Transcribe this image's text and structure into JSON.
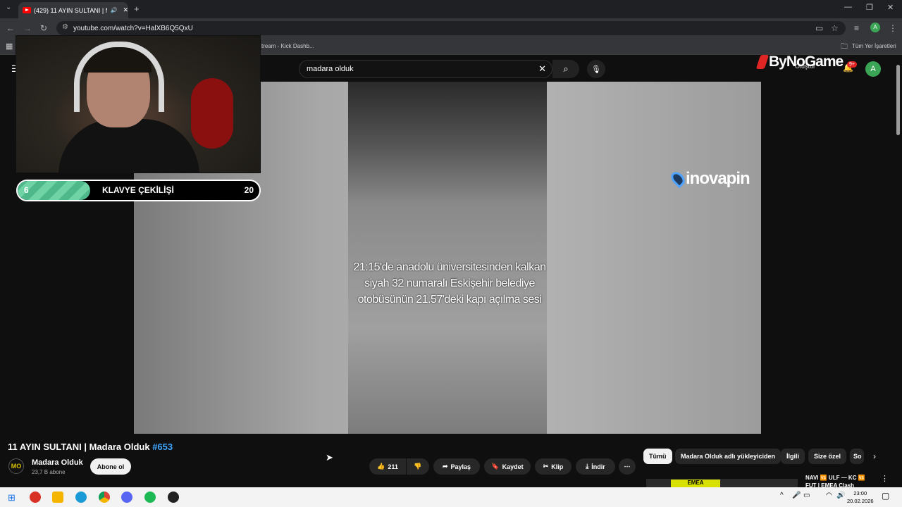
{
  "browser": {
    "tab_title": "(429) 11 AYIN SULTANI | M...",
    "url": "youtube.com/watch?v=HalXB6Q5QxU",
    "bookmark_partial": "tream - Kick Dashb...",
    "all_bookmarks": "Tüm Yer İşaretleri"
  },
  "youtube": {
    "search_query": "madara olduk",
    "create_label": "Oluştur",
    "notification_count": "9+",
    "avatar_letter": "A"
  },
  "overlay": {
    "giveaway_label": "KLAVYE ÇEKİLİŞİ",
    "giveaway_current": "6",
    "giveaway_target": "20",
    "giveaway_progress": 0.3,
    "sponsor_brand": "ByNoGame",
    "video_watermark": "inovapin",
    "channel_watermark": "MO"
  },
  "video": {
    "caption": "21:15'de anadolu üniversitesinden kalkan siyah 32 numaralı Eskişehir belediye otobüsünün 21.57'deki kapı açılma sesi",
    "title": "11 AYIN SULTANI | Madara Olduk",
    "episode": "#653",
    "channel_name": "Madara Olduk",
    "channel_subs": "23,7 B abone",
    "subscribe_label": "Abone ol",
    "likes": "211",
    "share_label": "Paylaş",
    "save_label": "Kaydet",
    "clip_label": "Klip",
    "download_label": "İndir"
  },
  "chips": [
    "Tümü",
    "Madara Olduk adlı yükleyiciden",
    "İlgili",
    "Size özel",
    "So"
  ],
  "recommended": {
    "thumb_text": "EMEA",
    "title": "NAVI 🆚 ULF — KC 🆚 FUT | EMEA Clash"
  },
  "taskbar": {
    "time": "23:00",
    "date": "20.02.2026"
  }
}
